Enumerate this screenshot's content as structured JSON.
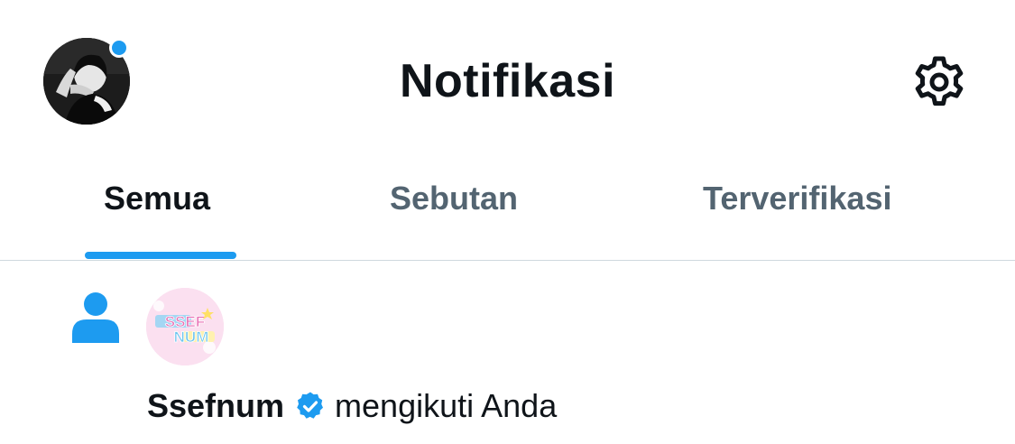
{
  "header": {
    "title": "Notifikasi",
    "avatar_icon": "profile-avatar",
    "settings_icon": "gear-icon",
    "unread_dot_color": "#1d9bf0"
  },
  "tabs": [
    {
      "label": "Semua",
      "active": true
    },
    {
      "label": "Sebutan",
      "active": false
    },
    {
      "label": "Terverifikasi",
      "active": false
    }
  ],
  "notifications": [
    {
      "type_icon": "person-icon",
      "avatar_text_line1": "SSEF",
      "avatar_text_line2": "NUM",
      "name": "Ssefnum",
      "verified": true,
      "action": "mengikuti Anda"
    }
  ],
  "colors": {
    "accent": "#1d9bf0",
    "text_primary": "#0f1419",
    "text_secondary": "#536471",
    "divider": "#cfd9de"
  }
}
